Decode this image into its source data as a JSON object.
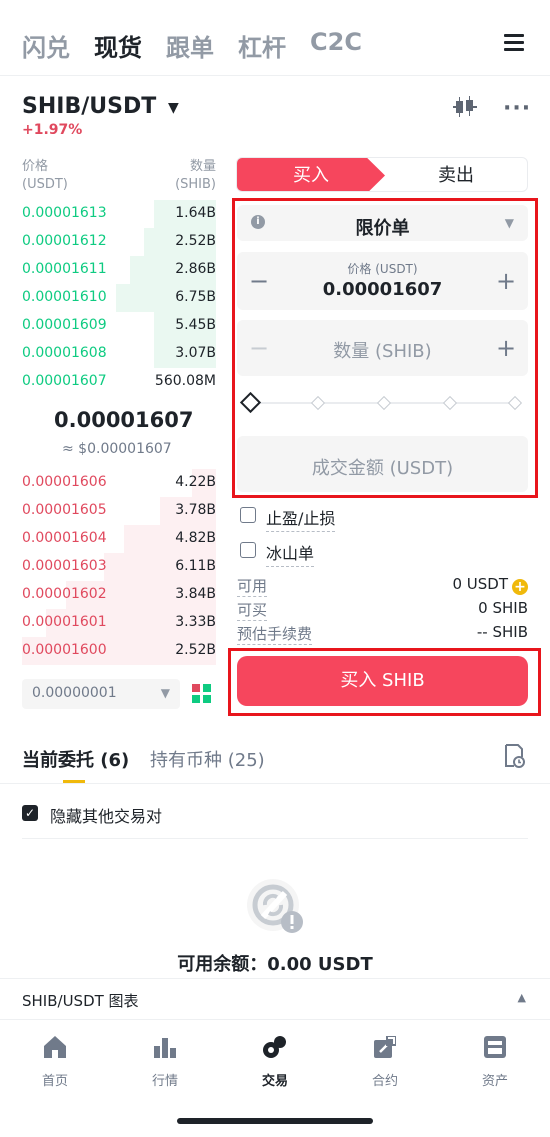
{
  "topnav": {
    "tabs": [
      "闪兑",
      "现货",
      "跟单",
      "杠杆",
      "C2C"
    ],
    "active": "现货",
    "menu_icon": "hamburger-menu-icon"
  },
  "pair": {
    "symbol": "SHIB/USDT",
    "change": "+1.97%",
    "change_color": "#e0495e"
  },
  "orderbook": {
    "price_header": "价格",
    "price_unit": "(USDT)",
    "qty_header": "数量",
    "qty_unit": "(SHIB)",
    "bids": [
      {
        "price": "0.00001613",
        "qty": "1.64B"
      },
      {
        "price": "0.00001612",
        "qty": "2.52B"
      },
      {
        "price": "0.00001611",
        "qty": "2.86B"
      },
      {
        "price": "0.00001610",
        "qty": "6.75B"
      },
      {
        "price": "0.00001609",
        "qty": "5.45B"
      },
      {
        "price": "0.00001608",
        "qty": "3.07B"
      },
      {
        "price": "0.00001607",
        "qty": "560.08M"
      }
    ],
    "last_price": "0.00001607",
    "last_price_usd": "≈ $0.00001607",
    "asks": [
      {
        "price": "0.00001606",
        "qty": "4.22B"
      },
      {
        "price": "0.00001605",
        "qty": "3.78B"
      },
      {
        "price": "0.00001604",
        "qty": "4.82B"
      },
      {
        "price": "0.00001603",
        "qty": "6.11B"
      },
      {
        "price": "0.00001602",
        "qty": "3.84B"
      },
      {
        "price": "0.00001601",
        "qty": "3.33B"
      },
      {
        "price": "0.00001600",
        "qty": "2.52B"
      }
    ],
    "precision": "0.00000001",
    "bid_color": "#0ecb81",
    "ask_color": "#e0495e"
  },
  "trade": {
    "buy_tab": "买入",
    "sell_tab": "卖出",
    "order_type": "限价单",
    "price_label": "价格 (USDT)",
    "price_value": "0.00001607",
    "qty_placeholder": "数量 (SHIB)",
    "slider_percent": 0,
    "total_placeholder": "成交金额 (USDT)",
    "tp_sl": "止盈/止损",
    "iceberg": "冰山单",
    "available_label": "可用",
    "available_value": "0 USDT",
    "can_buy_label": "可买",
    "can_buy_value": "0 SHIB",
    "fee_label": "预估手续费",
    "fee_value": "-- SHIB",
    "buy_button": "买入 SHIB",
    "accent": "#f6465d"
  },
  "orders": {
    "tab_open": "当前委托 (6)",
    "tab_holdings": "持有币种 (25)",
    "hide_others": "隐藏其他交易对",
    "balance_text": "可用余额：0.00 USDT"
  },
  "chart_bar": {
    "label": "SHIB/USDT 图表"
  },
  "bottomnav": {
    "items": [
      {
        "label": "首页",
        "icon": "home-icon"
      },
      {
        "label": "行情",
        "icon": "markets-icon"
      },
      {
        "label": "交易",
        "icon": "trade-icon"
      },
      {
        "label": "合约",
        "icon": "futures-icon"
      },
      {
        "label": "资产",
        "icon": "wallet-icon"
      }
    ],
    "active": "交易"
  }
}
